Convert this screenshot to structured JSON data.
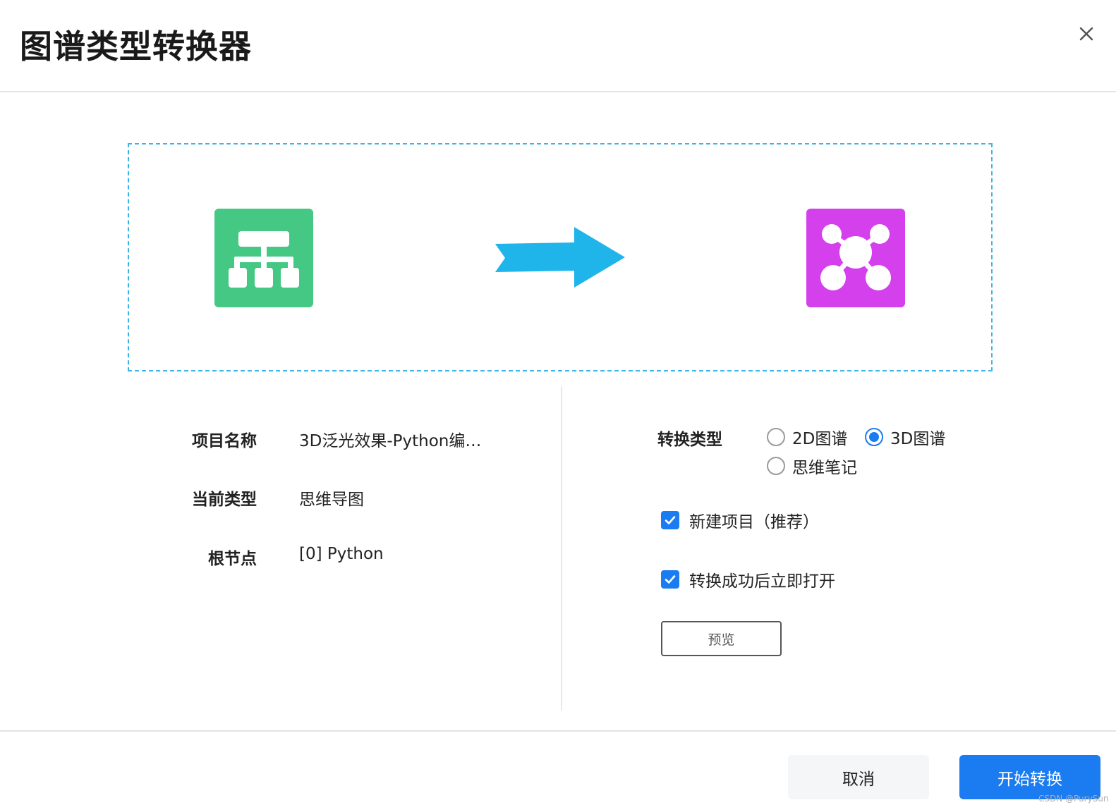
{
  "dialog": {
    "title": "图谱类型转换器",
    "close_icon": "close-icon"
  },
  "preview": {
    "source_icon": "hierarchy-tree-icon",
    "arrow_icon": "arrow-right-icon",
    "target_icon": "network-graph-icon",
    "source_color": "#45c883",
    "target_color": "#d440ec",
    "arrow_color": "#1fb4ea",
    "border_color": "#3fb4e6"
  },
  "info": {
    "project_name_label": "项目名称",
    "project_name_value": "3D泛光效果-Python编…",
    "current_type_label": "当前类型",
    "current_type_value": "思维导图",
    "root_node_label": "根节点",
    "root_node_value": "[0] Python"
  },
  "options": {
    "conversion_type_label": "转换类型",
    "radios": [
      {
        "label": "2D图谱",
        "checked": false
      },
      {
        "label": "3D图谱",
        "checked": true
      },
      {
        "label": "思维笔记",
        "checked": false
      }
    ],
    "checkboxes": [
      {
        "label": "新建项目（推荐）",
        "checked": true
      },
      {
        "label": "转换成功后立即打开",
        "checked": true
      }
    ],
    "preview_button": "预览"
  },
  "footer": {
    "cancel": "取消",
    "start": "开始转换",
    "accent_color": "#1a7cf0"
  },
  "watermark": "CSDN @PurySun"
}
